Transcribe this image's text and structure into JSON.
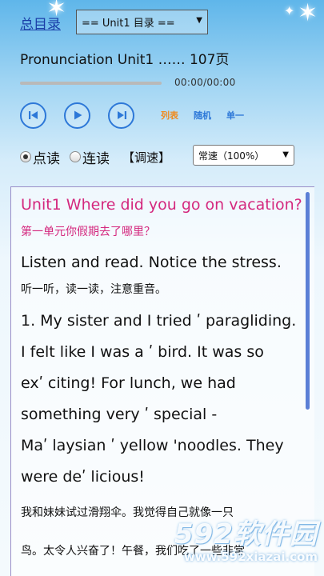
{
  "nav": {
    "toc_label": "总目录",
    "unit_select_value": "== Unit1 目录 =="
  },
  "player": {
    "track_title": "Pronunciation Unit1 …… 107页",
    "progress": 0,
    "time": "00:00/00:00",
    "buttons": {
      "prev_icon": "skip-back-icon",
      "play_icon": "play-icon",
      "next_icon": "skip-forward-icon"
    },
    "modes": [
      "列表",
      "随机",
      "单一"
    ],
    "accent_color": "#2d78d8",
    "list_color": "#f08a1c"
  },
  "options": {
    "read_label": "点读",
    "continuous_label": "连读",
    "read_checked": true,
    "tune_label": "【调速】",
    "speed_value": "常速（100%）"
  },
  "content": {
    "title": "Unit1 Where did you go on vacation?",
    "subtitle": "第一单元你假期去了哪里？",
    "instruction_en": "Listen and read. Notice the stress.",
    "instruction_cn": "听一听，读一读，注意重音。",
    "passage_lines": [
      "1. My sister and I tried ʹ paragliding.",
      "I felt like I was a ʹ bird. It was so",
      "exʹ citing! For lunch, we had",
      "something very ʹ special -",
      "Maʹ laysian ʹ yellow 'noodles. They",
      "were deʹ licious!"
    ],
    "translation_lines": [
      "我和妹妹试过滑翔伞。我觉得自己就像一只",
      "鸟。太令人兴奋了！午餐，我们吃了一些非常"
    ],
    "title_color": "#d4287e"
  },
  "watermark": {
    "logo": "592软件园",
    "url": "www.592xiazai.com"
  }
}
